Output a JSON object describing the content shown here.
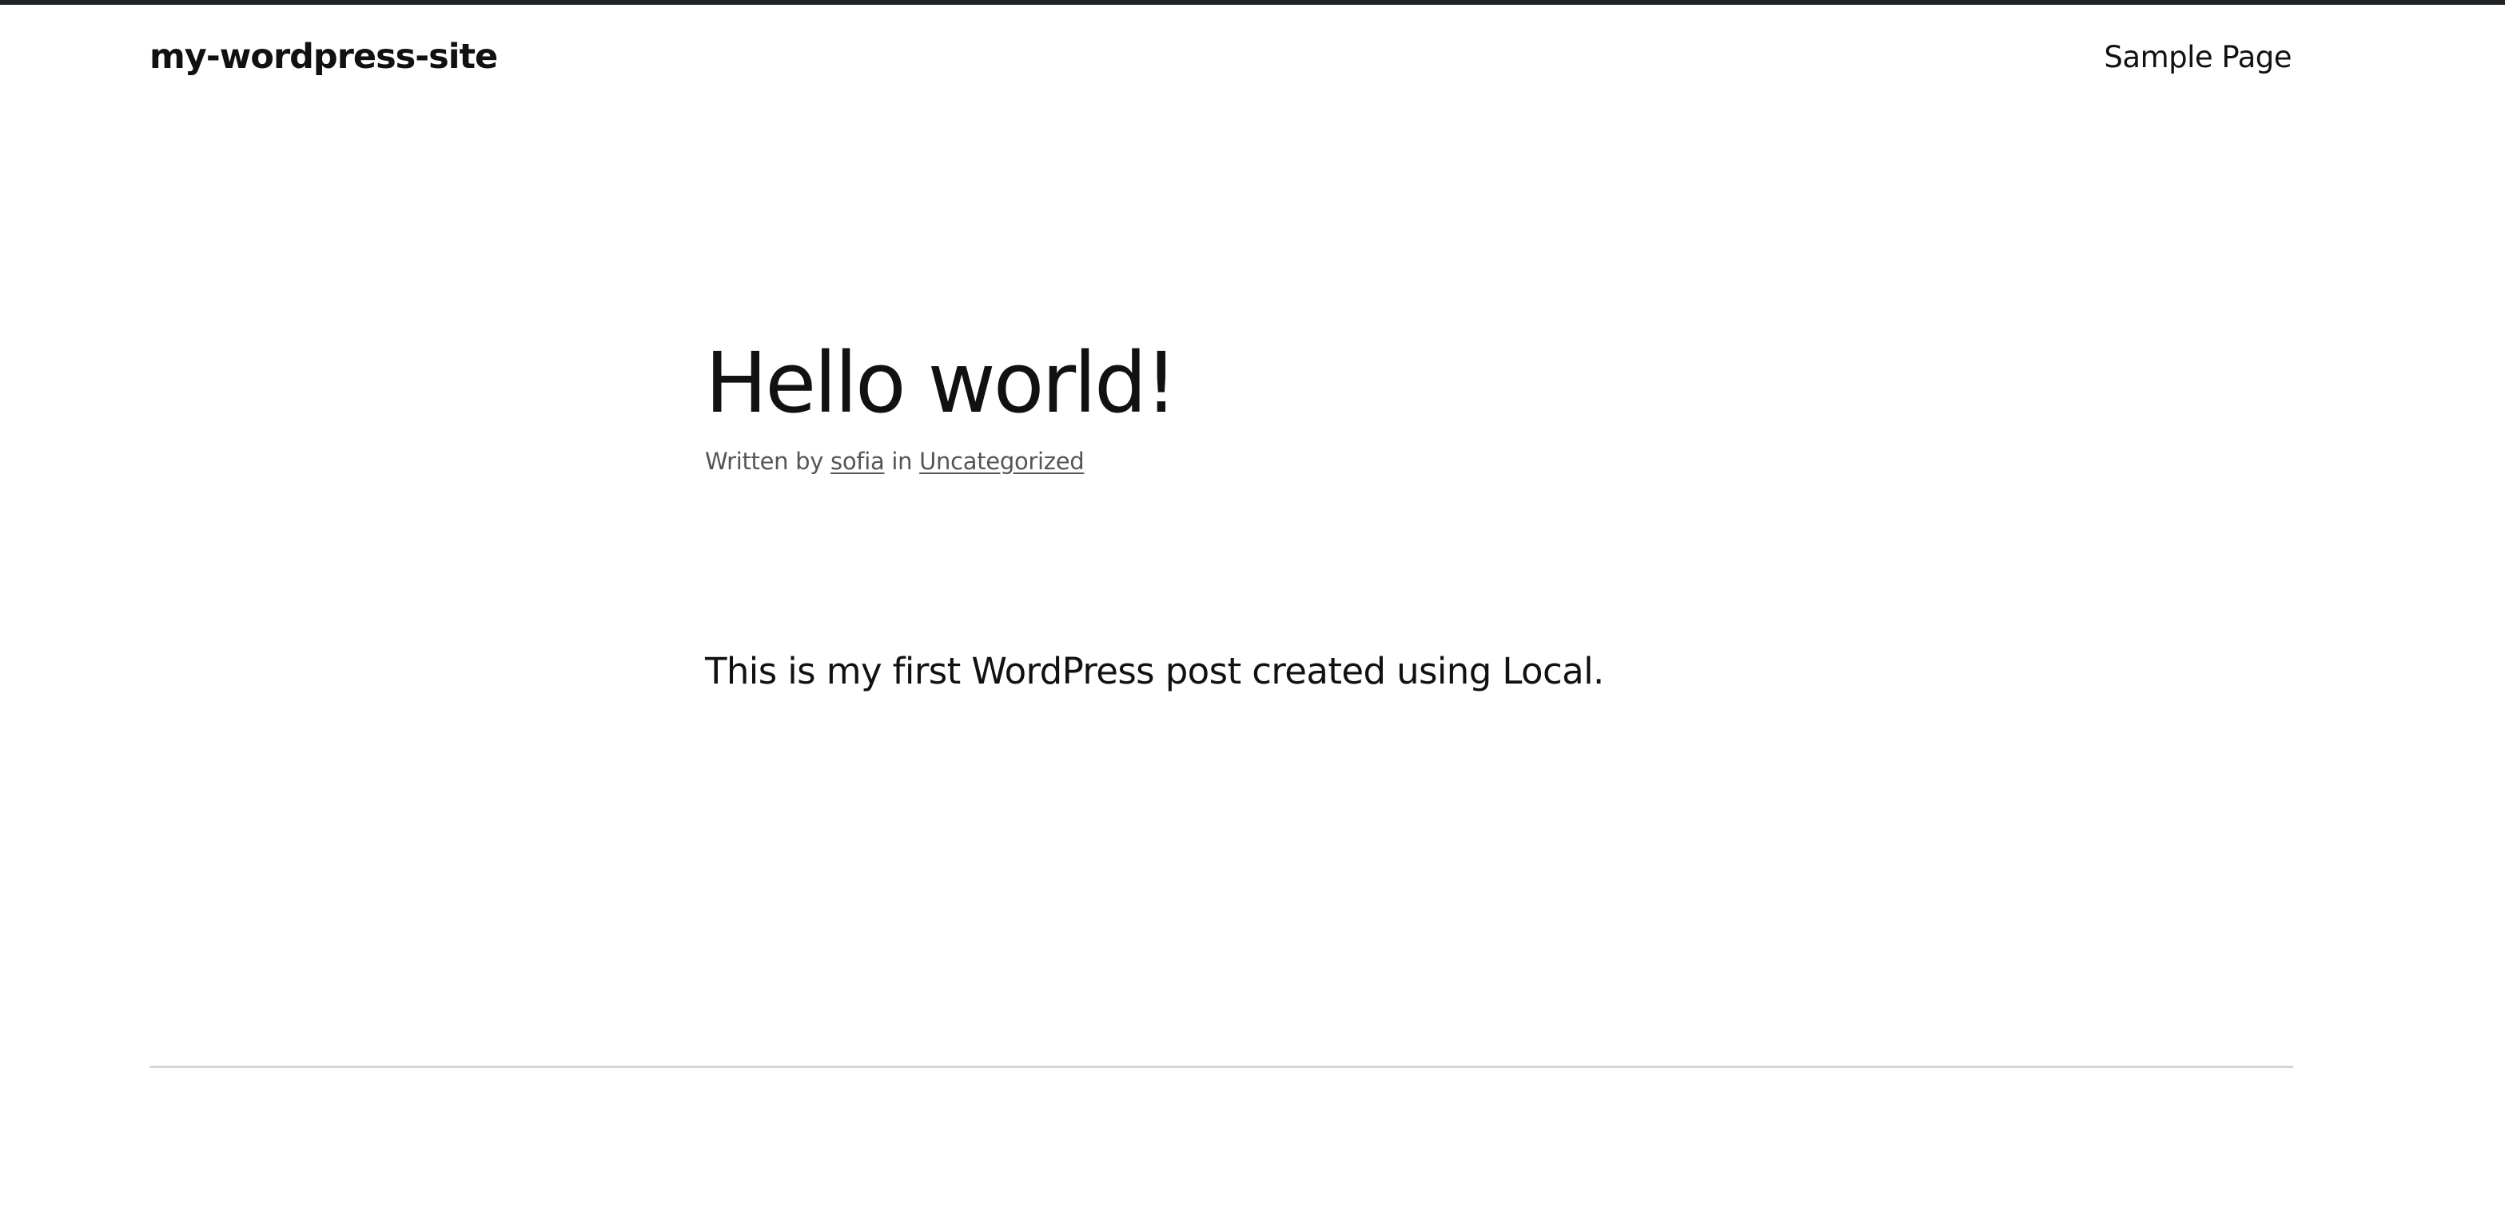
{
  "header": {
    "site_title": "my-wordpress-site",
    "nav": [
      {
        "label": "Sample Page"
      }
    ]
  },
  "post": {
    "title": "Hello world!",
    "meta": {
      "written_by_label": "Written by",
      "author": "sofia",
      "in_label": "in",
      "category": "Uncategorized"
    },
    "content": "This is my first WordPress post created using Local."
  },
  "colors": {
    "top_bar": "#1f2326",
    "text": "#111111",
    "meta_text": "#555555",
    "divider": "#d6d6d6",
    "background": "#ffffff"
  }
}
